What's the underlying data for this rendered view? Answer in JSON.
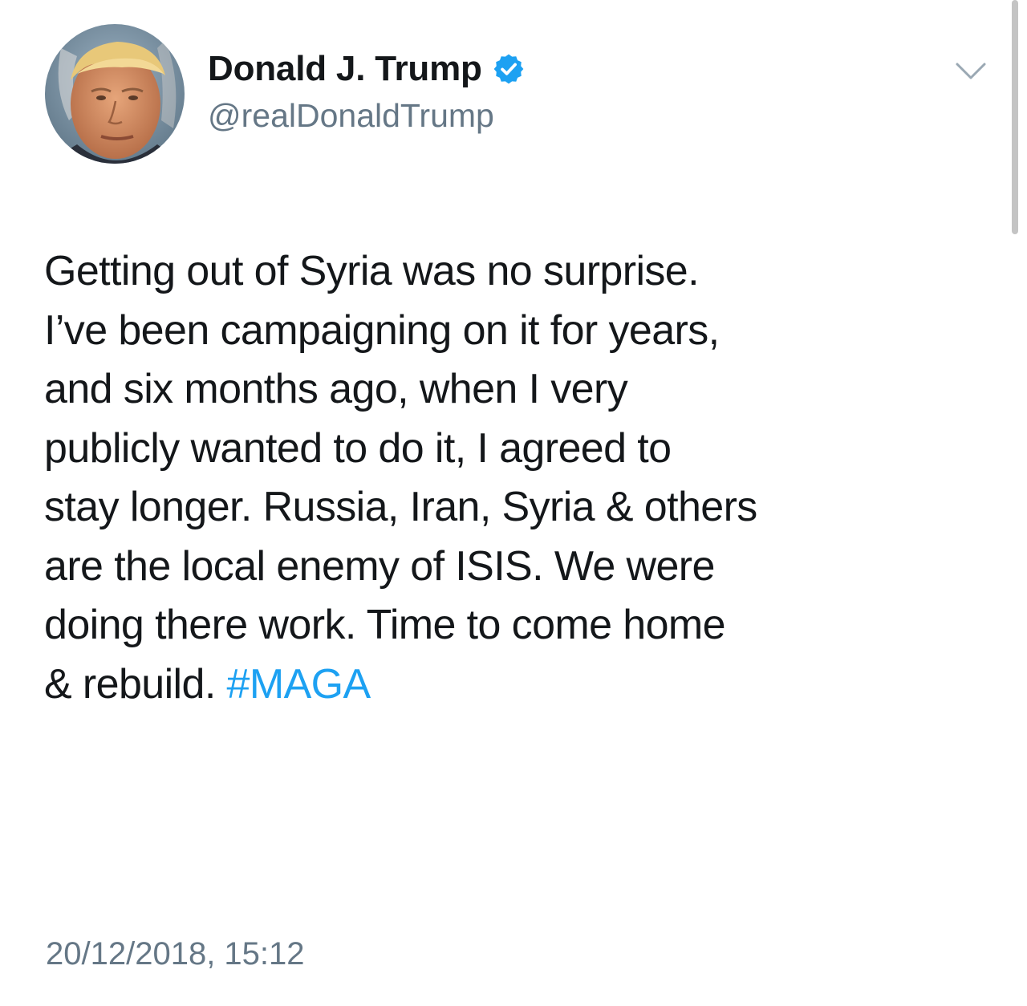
{
  "author": {
    "display_name": "Donald J. Trump",
    "handle": "@realDonaldTrump",
    "verified": true,
    "verified_icon": "verified-badge-icon",
    "avatar": "profile-photo"
  },
  "menu": {
    "icon": "chevron-down-icon"
  },
  "tweet": {
    "lines": [
      "Getting out of Syria was no surprise.",
      "I’ve been campaigning on it for years,",
      "and six months ago, when I very",
      "publicly wanted to do it, I agreed to",
      "stay longer. Russia, Iran, Syria & others",
      "are the local enemy of ISIS. We were",
      "doing there work. Time to come home",
      "& rebuild."
    ],
    "hashtag": "#MAGA",
    "timestamp": "20/12/2018, 15:12"
  },
  "colors": {
    "text": "#14171a",
    "secondary": "#657786",
    "link": "#1da1f2",
    "verified": "#1da1f2"
  }
}
